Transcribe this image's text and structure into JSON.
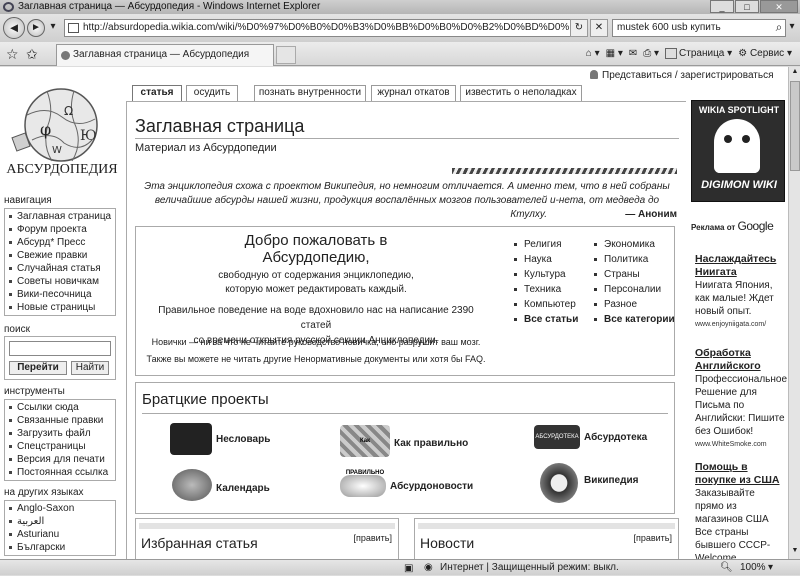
{
  "window": {
    "title": "Заглавная страница — Абсурдопедия - Windows Internet Explorer"
  },
  "browser": {
    "url": "http://absurdopedia.wikia.com/wiki/%D0%97%D0%B0%D0%B3%D0%BB%D0%B0%D0%B2%D0%BD%D0%B0%D1%",
    "search": "mustek 600 usb купить",
    "tab_title": "Заглавная страница — Абсурдопедия",
    "cmd_page": "Страница",
    "cmd_tools": "Сервис"
  },
  "status": {
    "zone": "Интернет | Защищенный режим: выкл.",
    "zoom": "100%"
  },
  "user": {
    "login": "Представиться / зарегистрироваться"
  },
  "page_tabs": [
    "статья",
    "осудить",
    "познать внутренности",
    "журнал откатов",
    "известить о неполадках"
  ],
  "logo": {
    "text": "АБСУРДОПЕДИЯ"
  },
  "navigation": {
    "title": "навигация",
    "items": [
      "Заглавная страница",
      "Форум проекта",
      "Абсурд* Пресс",
      "Свежие правки",
      "Случайная статья",
      "Советы новичкам",
      "Вики-песочница",
      "Новые страницы"
    ]
  },
  "search_box": {
    "title": "поиск",
    "go": "Перейти",
    "find": "Найти"
  },
  "tools": {
    "title": "инструменты",
    "items": [
      "Ссылки сюда",
      "Связанные правки",
      "Загрузить файл",
      "Спецстраницы",
      "Версия для печати",
      "Постоянная ссылка"
    ]
  },
  "languages": {
    "title": "на других языках",
    "items": [
      "Anglo-Saxon",
      "العربية",
      "Asturianu",
      "Български"
    ]
  },
  "content": {
    "heading": "Заглавная страница",
    "subtitle": "Материал из Абсурдопедии",
    "quote_line1": "Эта энциклопедия схожа с проектом Википедия, но немногим отличается. А именно тем, что в ней собраны",
    "quote_line2": "величайшие абсурды нашей жизни, продукция воспалённых мозгов пользователей и-нета, от медведа до",
    "quote_line3": "Ктулху.",
    "quote_author": "— Аноним"
  },
  "welcome": {
    "title": "Добро пожаловать в Абсурдопедию,",
    "sub1": "свободную от содержания энциклопедию,",
    "sub2": "которую может редактировать каждый.",
    "stat1": "Правильное поведение на воде вдохновило нас на написание 2390 статей",
    "stat2": "со времени открытия русской секции Анциклопедии.",
    "novice": "Новички — ни за что не читайте руководство новичка, оно разрушит ваш мозг.",
    "faq": "Также вы можете не читать другие Ненормативные документы или хотя бы FAQ.",
    "col1": [
      "Религия",
      "Наука",
      "Культура",
      "Техника",
      "Компьютер",
      "Все статьи"
    ],
    "col2": [
      "Экономика",
      "Политика",
      "Страны",
      "Персоналии",
      "Разное",
      "Все категории"
    ]
  },
  "projects": {
    "title": "Братцкие проекты",
    "items": [
      "Несловарь",
      "Как правильно",
      "Абсурдотека",
      "Календарь",
      "Абсурдоновости",
      "Википедия"
    ],
    "image_labels": [
      "Как ПРАВИЛЬНО",
      "АБСУРДОТЕКА"
    ]
  },
  "featured": {
    "title": "Избранная статья",
    "edit": "[править]"
  },
  "news": {
    "title": "Новости",
    "edit": "[править]"
  },
  "spotlight": {
    "header": "WIKIA SPOTLIGHT",
    "name": "DIGIMON WIKI"
  },
  "ads": {
    "by": "Реклама от",
    "google": "Google",
    "list": [
      {
        "title": "Наслаждайтесь Ниигата",
        "body": "Ниигата Япония, как малые! Ждет новый опыт.",
        "url": "www.enjoyniigata.com/"
      },
      {
        "title": "Обработка Английского",
        "body": "Профессиональное Решение для Письма по Английски: Пишите без Ошибок!",
        "url": "www.WhiteSmoke.com"
      },
      {
        "title": "Помощь в покупке из США",
        "body": "Заказывайте прямо из магазинов США Все страны бывшего СССР-Welcome",
        "url": ""
      }
    ]
  }
}
